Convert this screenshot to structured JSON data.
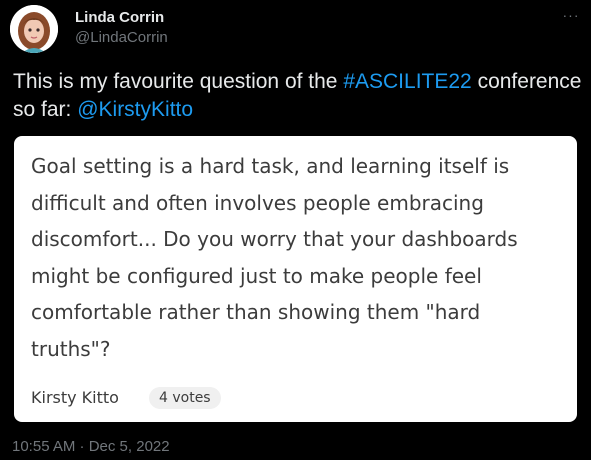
{
  "author": {
    "name": "Linda Corrin",
    "handle": "@LindaCorrin"
  },
  "more_icon": "more-horizontal-icon",
  "tweet": {
    "text_part1": "This is my favourite question of the ",
    "hashtag": "#ASCILITE22",
    "text_part2": " conference so far: ",
    "mention": "@KirstyKitto"
  },
  "card": {
    "question": "Goal setting is a hard task, and learning itself is\ndifficult and often involves people embracing\ndiscomfort... Do you worry that your dashboards\nmight be configured just to make people feel\ncomfortable rather than showing them \"hard\ntruths\"?",
    "asker": "Kirsty Kitto",
    "votes": "4 votes"
  },
  "timestamp": "10:55 AM · Dec 5, 2022",
  "colors": {
    "background": "#000000",
    "text": "#e7e9ea",
    "secondary": "#71767b",
    "link": "#1d9bf0",
    "card": "#ffffff"
  }
}
